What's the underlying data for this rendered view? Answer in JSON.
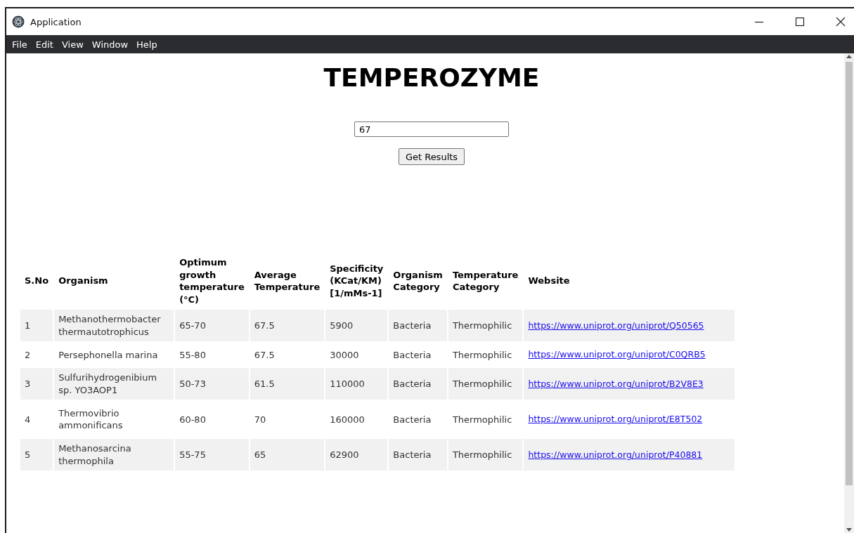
{
  "window": {
    "title": "Application"
  },
  "menu": [
    "File",
    "Edit",
    "View",
    "Window",
    "Help"
  ],
  "heading": "TEMPEROZYME",
  "search": {
    "value": "67"
  },
  "button": "Get Results",
  "table": {
    "columns": [
      "S.No",
      "Organism",
      "Optimum growth temperature (°C)",
      "Average Temperature",
      "Specificity (KCat/KM) [1/mMs-1]",
      "Organism Category",
      "Temperature Category",
      "Website"
    ],
    "rows": [
      [
        "1",
        "Methanothermobacter thermautotrophicus",
        "65-70",
        "67.5",
        "5900",
        "Bacteria",
        "Thermophilic",
        "https://www.uniprot.org/uniprot/Q50565"
      ],
      [
        "2",
        "Persephonella marina",
        "55-80",
        "67.5",
        "30000",
        "Bacteria",
        "Thermophilic",
        "https://www.uniprot.org/uniprot/C0QRB5"
      ],
      [
        "3",
        "Sulfurihydrogenibium sp. YO3AOP1",
        "50-73",
        "61.5",
        "110000",
        "Bacteria",
        "Thermophilic",
        "https://www.uniprot.org/uniprot/B2V8E3"
      ],
      [
        "4",
        "Thermovibrio ammonificans",
        "60-80",
        "70",
        "160000",
        "Bacteria",
        "Thermophilic",
        "https://www.uniprot.org/uniprot/E8T502"
      ],
      [
        "5",
        "Methanosarcina thermophila",
        "55-75",
        "65",
        "62900",
        "Bacteria",
        "Thermophilic",
        "https://www.uniprot.org/uniprot/P40881"
      ]
    ]
  }
}
